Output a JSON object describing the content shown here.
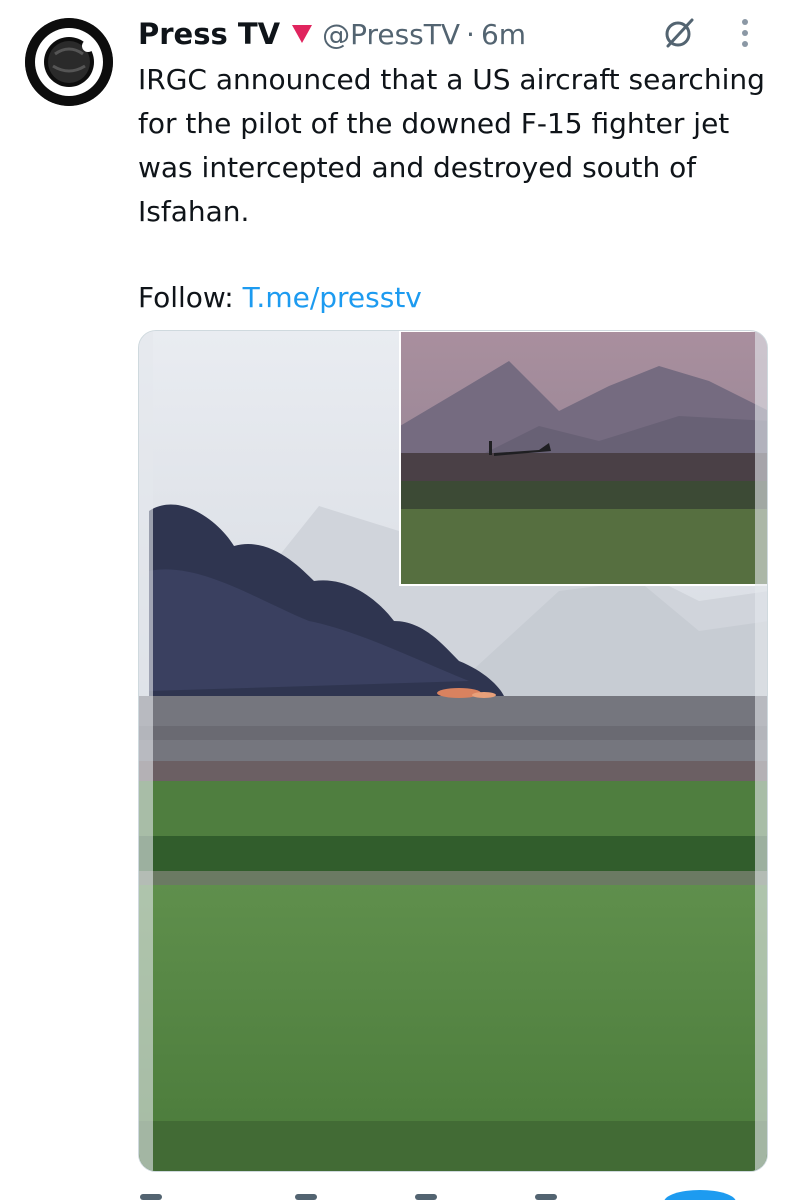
{
  "tweet": {
    "display_name": "Press TV",
    "handle": "@PressTV",
    "separator": "·",
    "time": "6m",
    "text": "IRGC announced that a US aircraft searching for the pilot of the downed F-15 fighter jet was intercepted and destroyed south of Isfahan.",
    "follow_label": "Follow:",
    "follow_link": "T.me/presstv"
  },
  "icons": {
    "avatar": "presstv-logo",
    "affiliation": "red-triangle-flag-icon",
    "grok": "grok-icon",
    "more": "more-vertical-icon"
  },
  "colors": {
    "text": "#0f1419",
    "muted": "#536471",
    "link": "#1d9bf0",
    "flag": "#e0245e"
  }
}
